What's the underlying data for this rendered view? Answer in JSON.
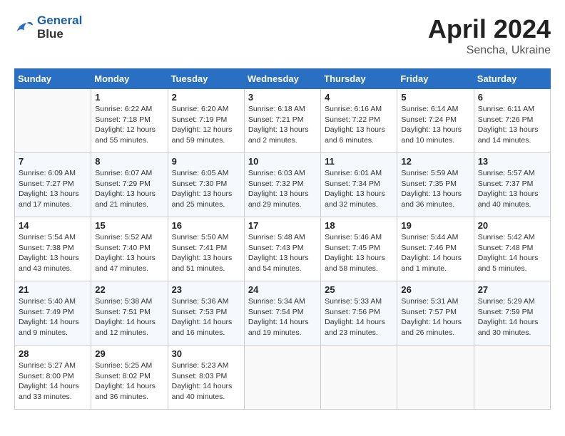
{
  "header": {
    "logo_line1": "General",
    "logo_line2": "Blue",
    "title": "April 2024",
    "subtitle": "Sencha, Ukraine"
  },
  "days_of_week": [
    "Sunday",
    "Monday",
    "Tuesday",
    "Wednesday",
    "Thursday",
    "Friday",
    "Saturday"
  ],
  "weeks": [
    [
      {
        "day": "",
        "info": ""
      },
      {
        "day": "1",
        "info": "Sunrise: 6:22 AM\nSunset: 7:18 PM\nDaylight: 12 hours\nand 55 minutes."
      },
      {
        "day": "2",
        "info": "Sunrise: 6:20 AM\nSunset: 7:19 PM\nDaylight: 12 hours\nand 59 minutes."
      },
      {
        "day": "3",
        "info": "Sunrise: 6:18 AM\nSunset: 7:21 PM\nDaylight: 13 hours\nand 2 minutes."
      },
      {
        "day": "4",
        "info": "Sunrise: 6:16 AM\nSunset: 7:22 PM\nDaylight: 13 hours\nand 6 minutes."
      },
      {
        "day": "5",
        "info": "Sunrise: 6:14 AM\nSunset: 7:24 PM\nDaylight: 13 hours\nand 10 minutes."
      },
      {
        "day": "6",
        "info": "Sunrise: 6:11 AM\nSunset: 7:26 PM\nDaylight: 13 hours\nand 14 minutes."
      }
    ],
    [
      {
        "day": "7",
        "info": "Sunrise: 6:09 AM\nSunset: 7:27 PM\nDaylight: 13 hours\nand 17 minutes."
      },
      {
        "day": "8",
        "info": "Sunrise: 6:07 AM\nSunset: 7:29 PM\nDaylight: 13 hours\nand 21 minutes."
      },
      {
        "day": "9",
        "info": "Sunrise: 6:05 AM\nSunset: 7:30 PM\nDaylight: 13 hours\nand 25 minutes."
      },
      {
        "day": "10",
        "info": "Sunrise: 6:03 AM\nSunset: 7:32 PM\nDaylight: 13 hours\nand 29 minutes."
      },
      {
        "day": "11",
        "info": "Sunrise: 6:01 AM\nSunset: 7:34 PM\nDaylight: 13 hours\nand 32 minutes."
      },
      {
        "day": "12",
        "info": "Sunrise: 5:59 AM\nSunset: 7:35 PM\nDaylight: 13 hours\nand 36 minutes."
      },
      {
        "day": "13",
        "info": "Sunrise: 5:57 AM\nSunset: 7:37 PM\nDaylight: 13 hours\nand 40 minutes."
      }
    ],
    [
      {
        "day": "14",
        "info": "Sunrise: 5:54 AM\nSunset: 7:38 PM\nDaylight: 13 hours\nand 43 minutes."
      },
      {
        "day": "15",
        "info": "Sunrise: 5:52 AM\nSunset: 7:40 PM\nDaylight: 13 hours\nand 47 minutes."
      },
      {
        "day": "16",
        "info": "Sunrise: 5:50 AM\nSunset: 7:41 PM\nDaylight: 13 hours\nand 51 minutes."
      },
      {
        "day": "17",
        "info": "Sunrise: 5:48 AM\nSunset: 7:43 PM\nDaylight: 13 hours\nand 54 minutes."
      },
      {
        "day": "18",
        "info": "Sunrise: 5:46 AM\nSunset: 7:45 PM\nDaylight: 13 hours\nand 58 minutes."
      },
      {
        "day": "19",
        "info": "Sunrise: 5:44 AM\nSunset: 7:46 PM\nDaylight: 14 hours\nand 1 minute."
      },
      {
        "day": "20",
        "info": "Sunrise: 5:42 AM\nSunset: 7:48 PM\nDaylight: 14 hours\nand 5 minutes."
      }
    ],
    [
      {
        "day": "21",
        "info": "Sunrise: 5:40 AM\nSunset: 7:49 PM\nDaylight: 14 hours\nand 9 minutes."
      },
      {
        "day": "22",
        "info": "Sunrise: 5:38 AM\nSunset: 7:51 PM\nDaylight: 14 hours\nand 12 minutes."
      },
      {
        "day": "23",
        "info": "Sunrise: 5:36 AM\nSunset: 7:53 PM\nDaylight: 14 hours\nand 16 minutes."
      },
      {
        "day": "24",
        "info": "Sunrise: 5:34 AM\nSunset: 7:54 PM\nDaylight: 14 hours\nand 19 minutes."
      },
      {
        "day": "25",
        "info": "Sunrise: 5:33 AM\nSunset: 7:56 PM\nDaylight: 14 hours\nand 23 minutes."
      },
      {
        "day": "26",
        "info": "Sunrise: 5:31 AM\nSunset: 7:57 PM\nDaylight: 14 hours\nand 26 minutes."
      },
      {
        "day": "27",
        "info": "Sunrise: 5:29 AM\nSunset: 7:59 PM\nDaylight: 14 hours\nand 30 minutes."
      }
    ],
    [
      {
        "day": "28",
        "info": "Sunrise: 5:27 AM\nSunset: 8:00 PM\nDaylight: 14 hours\nand 33 minutes."
      },
      {
        "day": "29",
        "info": "Sunrise: 5:25 AM\nSunset: 8:02 PM\nDaylight: 14 hours\nand 36 minutes."
      },
      {
        "day": "30",
        "info": "Sunrise: 5:23 AM\nSunset: 8:03 PM\nDaylight: 14 hours\nand 40 minutes."
      },
      {
        "day": "",
        "info": ""
      },
      {
        "day": "",
        "info": ""
      },
      {
        "day": "",
        "info": ""
      },
      {
        "day": "",
        "info": ""
      }
    ]
  ]
}
